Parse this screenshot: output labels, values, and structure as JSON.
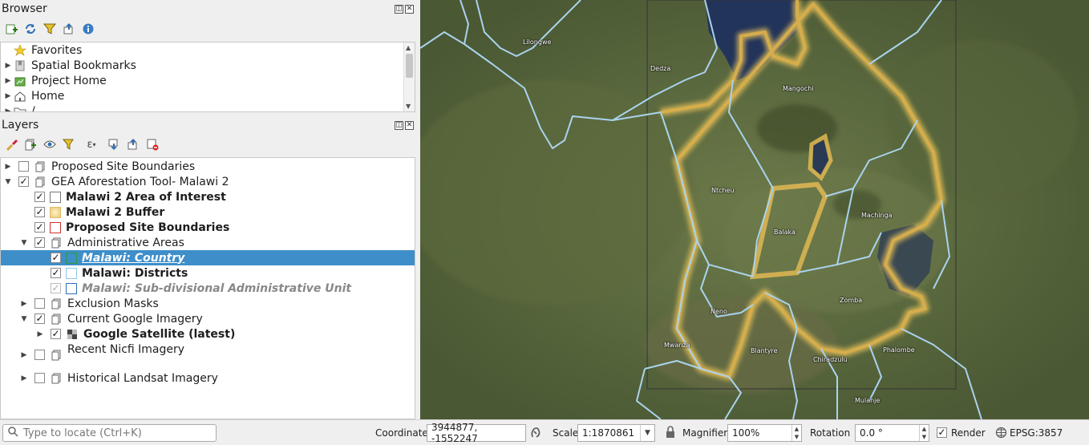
{
  "browser": {
    "title": "Browser",
    "items": [
      {
        "label": "Favorites",
        "icon": "star-icon"
      },
      {
        "label": "Spatial Bookmarks",
        "icon": "bookmarks-icon"
      },
      {
        "label": "Project Home",
        "icon": "project-home-icon"
      },
      {
        "label": "Home",
        "icon": "home-icon"
      },
      {
        "label": "/",
        "icon": "folder-icon"
      }
    ]
  },
  "layers": {
    "title": "Layers",
    "items": [
      {
        "label": "Proposed Site Boundaries"
      },
      {
        "label": "GEA Aforestation Tool- Malawi 2"
      },
      {
        "label": "Malawi 2 Area of Interest"
      },
      {
        "label": "Malawi 2 Buffer"
      },
      {
        "label": "Proposed Site Boundaries"
      },
      {
        "label": "Administrative Areas"
      },
      {
        "label": "Malawi: Country"
      },
      {
        "label": "Malawi: Districts"
      },
      {
        "label": "Malawi: Sub-divisional Administrative Unit"
      },
      {
        "label": "Exclusion Masks"
      },
      {
        "label": "Current Google Imagery"
      },
      {
        "label": "Google Satellite (latest)"
      },
      {
        "label": "Recent Nicfi Imagery"
      },
      {
        "label": "Historical Landsat Imagery"
      }
    ]
  },
  "map": {
    "places": [
      "Lilongwe",
      "Dedza",
      "Mangochi",
      "Ntcheu",
      "Balaka",
      "Machinga",
      "Neno",
      "Zomba",
      "Mwanza",
      "Blantyre",
      "Chiradzulu",
      "Phalombe",
      "Mulanje"
    ]
  },
  "status": {
    "locate_placeholder": "Type to locate (Ctrl+K)",
    "coordinate_label": "Coordinate",
    "coordinate_value": "3944877, -1552247",
    "scale_label": "Scale",
    "scale_value": "1:1870861",
    "magnifier_label": "Magnifier",
    "magnifier_value": "100%",
    "rotation_label": "Rotation",
    "rotation_value": "0.0 °",
    "render_label": "Render",
    "crs": "EPSG:3857"
  }
}
